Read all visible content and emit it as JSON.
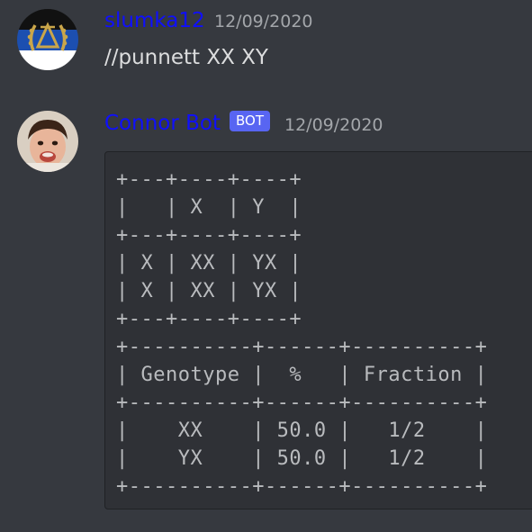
{
  "messages": [
    {
      "username": "slumka12",
      "timestamp": "12/09/2020",
      "text": "//punnett XX XY",
      "avatar_icon": "laurel-wreath-delta-emblem",
      "colors": {
        "username": "#0f0fff"
      }
    },
    {
      "username": "Connor Bot",
      "bot_tag": "BOT",
      "timestamp": "12/09/2020",
      "avatar_icon": "child-photo-avatar",
      "code": "+---+----+----+\n|   | X  | Y  |\n+---+----+----+\n| X | XX | YX |\n| X | XX | YX |\n+---+----+----+\n+----------+------+----------+\n| Genotype |  %   | Fraction |\n+----------+------+----------+\n|    XX    | 50.0 |   1/2    |\n|    YX    | 50.0 |   1/2    |\n+----------+------+----------+",
      "colors": {
        "username": "#0f0fff",
        "bot_tag_bg": "#5865f2"
      }
    }
  ],
  "theme": {
    "background": "#36393f",
    "codeblock_bg": "#2f3136",
    "timestamp": "#a3a6aa",
    "text": "#dcddde"
  }
}
